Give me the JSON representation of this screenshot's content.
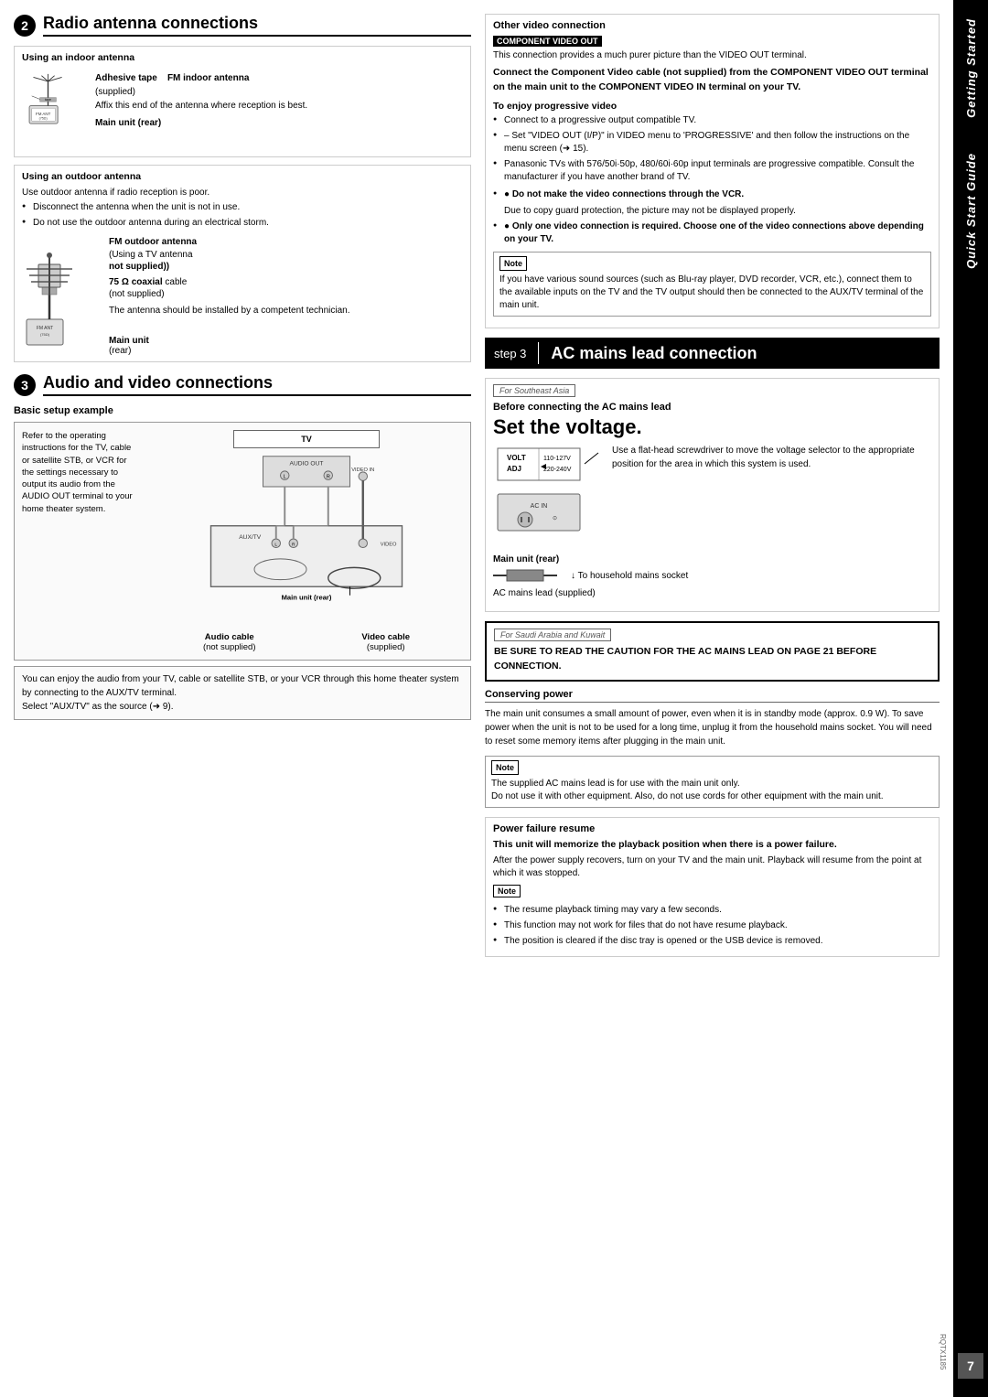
{
  "page": {
    "number": "7",
    "rqtx_code": "RQTX1185"
  },
  "tabs": {
    "getting_started": "Getting Started",
    "quick_start_guide": "Quick Start Guide"
  },
  "section2": {
    "number": "2",
    "title": "Radio antenna connections",
    "indoor_antenna": {
      "title": "Using an indoor antenna",
      "adhesive_tape_label": "Adhesive tape",
      "fm_antenna_label": "FM indoor antenna",
      "supplied_text": "(supplied)",
      "instruction": "Affix this end of the antenna where reception is best.",
      "main_unit_label": "Main unit (rear)"
    },
    "outdoor_antenna": {
      "title": "Using an outdoor antenna",
      "instruction1": "Use outdoor antenna if radio reception is poor.",
      "bullet1": "Disconnect the antenna when the unit is not in use.",
      "bullet2": "Do not use the outdoor antenna during an electrical storm.",
      "fm_outdoor_label": "FM outdoor antenna",
      "tv_antenna_note": "(Using a TV antenna",
      "not_supplied": "not supplied))",
      "coaxial_label": "75 Ω coaxial",
      "cable_label": "cable",
      "not_supplied2": "(not supplied)",
      "instruction2": "The antenna should be installed by a competent technician.",
      "main_unit_label": "Main unit",
      "rear": "(rear)"
    }
  },
  "section3": {
    "number": "3",
    "title": "Audio and video connections",
    "basic_setup_title": "Basic setup example",
    "tv_label": "TV",
    "setup_text": "Refer to the operating instructions for the TV, cable or satellite STB, or VCR for the settings necessary to output its audio from the AUDIO OUT terminal to your home theater system.",
    "audio_cable_label": "Audio cable",
    "audio_not_supplied": "(not supplied)",
    "video_cable_label": "Video cable",
    "video_supplied": "(supplied)",
    "main_unit_rear": "Main unit (rear)",
    "bottom_note": "You can enjoy the audio from your TV, cable or satellite STB, or your VCR through this home theater system by connecting to the AUX/TV terminal.\nSelect \"AUX/TV\" as the source (➜ 9)."
  },
  "right_column": {
    "other_video": {
      "title": "Other video connection",
      "component_badge": "COMPONENT VIDEO OUT",
      "intro": "This connection provides a much purer picture than the VIDEO OUT terminal.",
      "bold_instruction": "Connect the Component Video cable (not supplied) from the COMPONENT VIDEO OUT terminal on the main unit to the COMPONENT VIDEO IN terminal on your TV.",
      "progressive_title": "To enjoy progressive video",
      "progressive_bullets": [
        "Connect to a progressive output compatible TV.",
        "– Set \"VIDEO OUT (I/P)\" in VIDEO menu to 'PROGRESSIVE' and then follow the instructions on the menu screen (➜ 15).",
        "Panasonic TVs with 576/50i·50p, 480/60i·60p input terminals are progressive compatible. Consult the manufacturer if you have another brand of TV."
      ],
      "vcr_warning": "● Do not make the video connections through the VCR.",
      "vcr_warning_detail": "Due to copy guard protection, the picture may not be displayed properly.",
      "one_connection": "● Only one video connection is required. Choose one of the video connections above depending on your TV.",
      "note_text": "If you have various sound sources (such as Blu-ray player, DVD recorder, VCR, etc.), connect them to the available inputs on the TV and the TV output should then be connected to the AUX/TV terminal of the main unit."
    },
    "step3": {
      "step_label": "step 3",
      "title": "AC mains lead connection",
      "southeast_asia": {
        "region_label": "For Southeast Asia",
        "before_text": "Before connecting the AC mains lead",
        "set_voltage": "Set the voltage.",
        "volt_adj": "VOLT\nADJ",
        "volt_options": "110-127V   220-240V",
        "instruction": "Use a flat-head screwdriver to move the voltage selector to the appropriate position for the area in which this system is used."
      },
      "ac_labels": {
        "main_unit_rear": "Main unit (rear)",
        "household": "↓ To household mains socket",
        "ac_mains": "AC mains lead (supplied)"
      },
      "saudi_arabia": {
        "region_label": "For Saudi Arabia and Kuwait",
        "warning": "BE SURE TO READ THE CAUTION FOR THE AC MAINS LEAD ON PAGE 21 BEFORE CONNECTION."
      },
      "conserving_power": {
        "title": "Conserving power",
        "text": "The main unit consumes a small amount of power, even when it is in standby mode (approx. 0.9 W). To save power when the unit is not to be used for a long time, unplug it from the household mains socket. You will need to reset some memory items after plugging in the main unit."
      },
      "note_ac": "The supplied AC mains lead is for use with the main unit only.\nDo not use it with other equipment. Also, do not use cords for other equipment with the main unit.",
      "power_failure": {
        "title": "Power failure resume",
        "bold_text": "This unit will memorize the playback position when there is a power failure.",
        "text": "After the power supply recovers, turn on your TV and the main unit. Playback will resume from the point at which it was stopped.",
        "bullets": [
          "The resume playback timing may vary a few seconds.",
          "This function may not work for files that do not have resume playback.",
          "The position is cleared if the disc tray is opened or the USB device is removed."
        ]
      }
    }
  }
}
